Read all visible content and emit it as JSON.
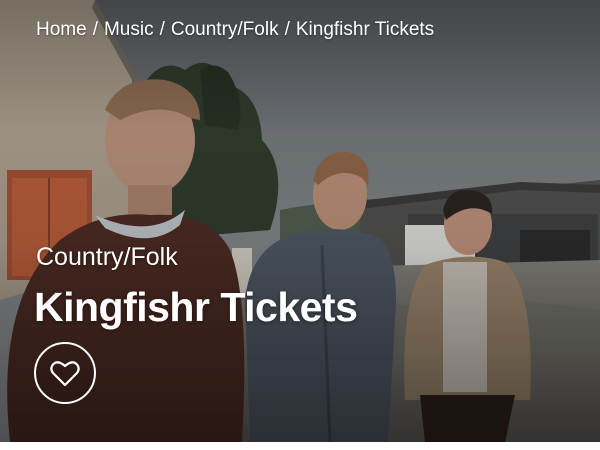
{
  "breadcrumb": {
    "items": [
      "Home",
      "Music",
      "Country/Folk",
      "Kingfishr Tickets"
    ],
    "separator": "/"
  },
  "hero": {
    "genre": "Country/Folk",
    "title": "Kingfishr Tickets"
  },
  "favorite": {
    "icon": "heart-outline-icon"
  },
  "colors": {
    "text": "#ffffff"
  }
}
